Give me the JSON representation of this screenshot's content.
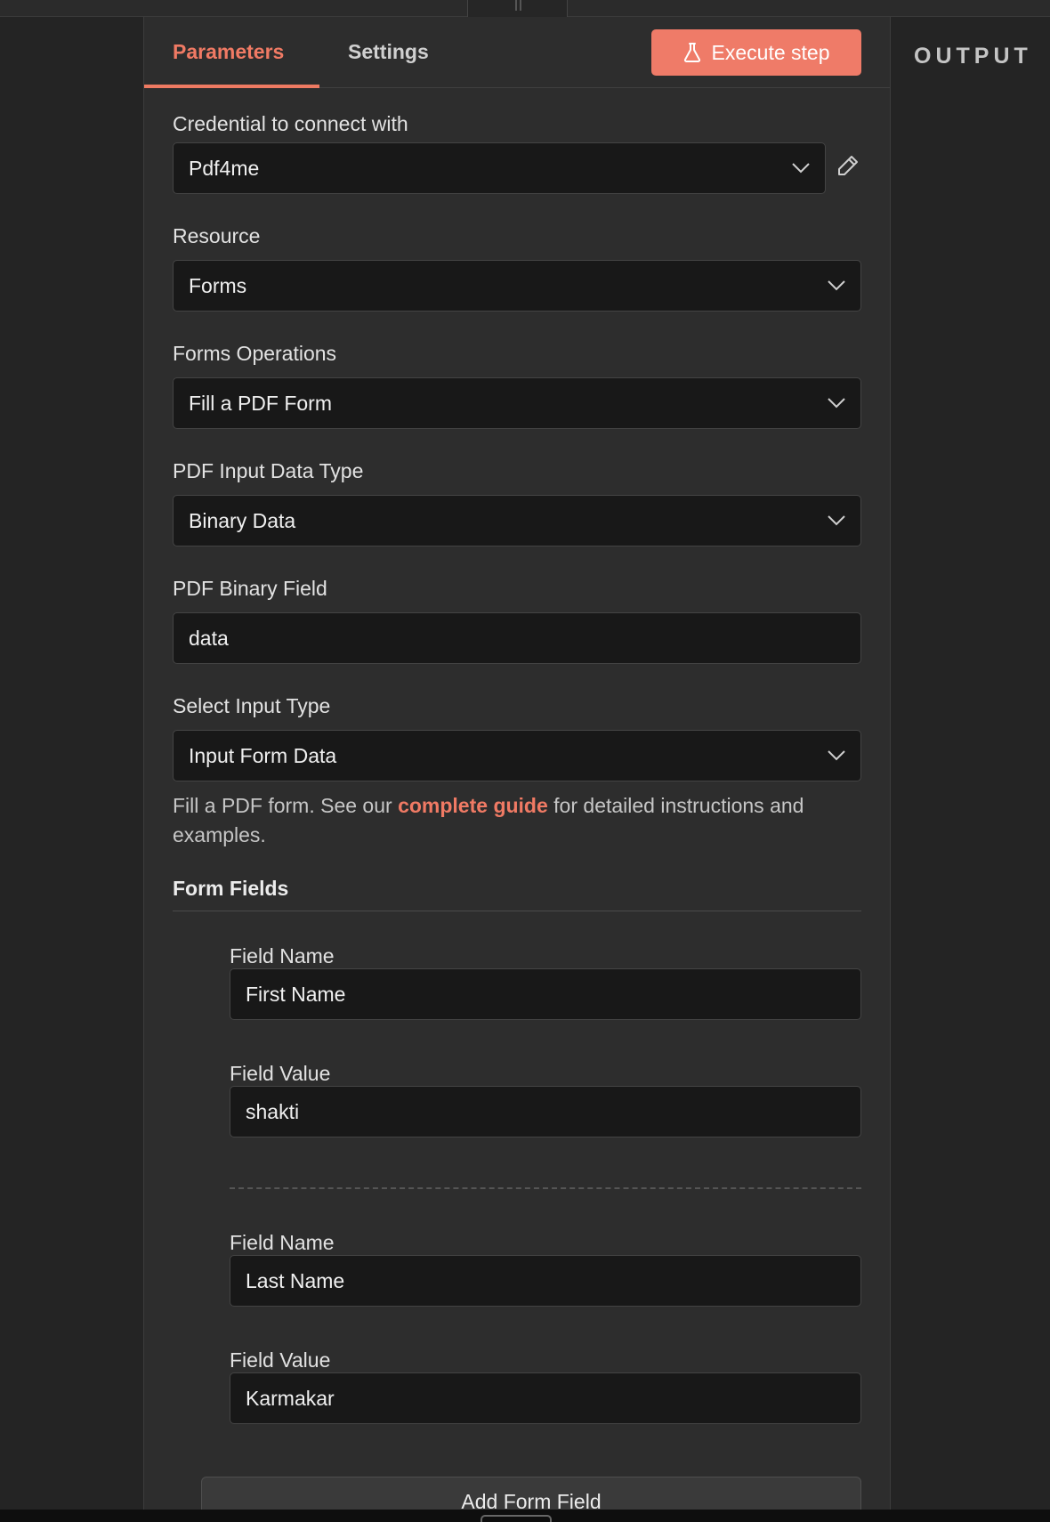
{
  "tabs": {
    "parameters": "Parameters",
    "settings": "Settings"
  },
  "execute_button": {
    "label": "Execute step",
    "icon": "flask-icon"
  },
  "output_label": "OUTPUT",
  "fields": {
    "credential": {
      "label": "Credential to connect with",
      "value": "Pdf4me"
    },
    "resource": {
      "label": "Resource",
      "value": "Forms"
    },
    "operation": {
      "label": "Forms Operations",
      "value": "Fill a PDF Form"
    },
    "input_data_type": {
      "label": "PDF Input Data Type",
      "value": "Binary Data"
    },
    "binary_field": {
      "label": "PDF Binary Field",
      "value": "data"
    },
    "input_type": {
      "label": "Select Input Type",
      "value": "Input Form Data"
    }
  },
  "hint": {
    "before": "Fill a PDF form. See our ",
    "link": "complete guide",
    "after": " for detailed instructions and examples."
  },
  "form_fields": {
    "title": "Form Fields",
    "items": [
      {
        "name_label": "Field Name",
        "name_value": "First Name",
        "value_label": "Field Value",
        "value_value": "shakti"
      },
      {
        "name_label": "Field Name",
        "name_value": "Last Name",
        "value_label": "Field Value",
        "value_value": "Karmakar"
      }
    ],
    "add_button": "Add Form Field"
  },
  "colors": {
    "accent": "#ef7b68",
    "background": "#2d2d2d",
    "input_bg": "#181818"
  }
}
